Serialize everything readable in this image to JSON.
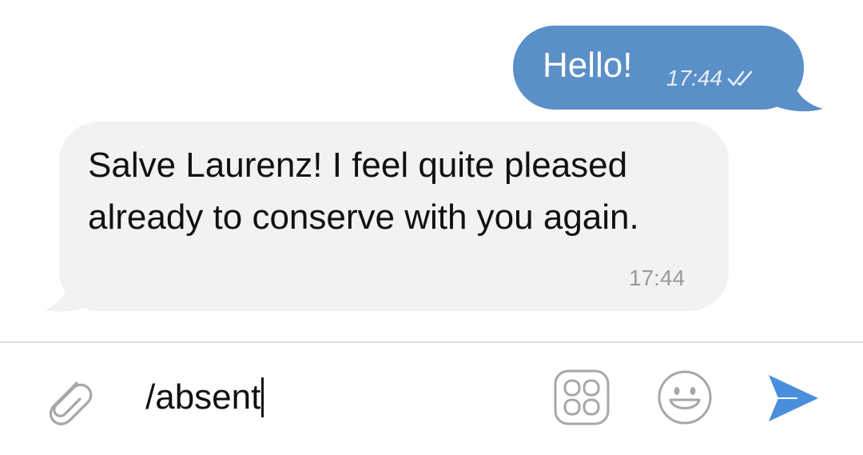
{
  "messages": [
    {
      "direction": "outgoing",
      "text": "Hello!",
      "time": "17:44",
      "status_icon": "double-check-icon",
      "bubble_color": "#5b8fc8"
    },
    {
      "direction": "incoming",
      "text": "Salve Laurenz! I feel quite pleased already to conserve with you again.",
      "time": "17:44",
      "bubble_color": "#f2f2f2"
    }
  ],
  "composer": {
    "value": "/absent",
    "attach_icon": "paperclip-icon",
    "commands_icon": "bot-commands-icon",
    "emoji_icon": "emoji-icon",
    "send_icon": "send-icon",
    "accent_color": "#4a8fdb"
  }
}
